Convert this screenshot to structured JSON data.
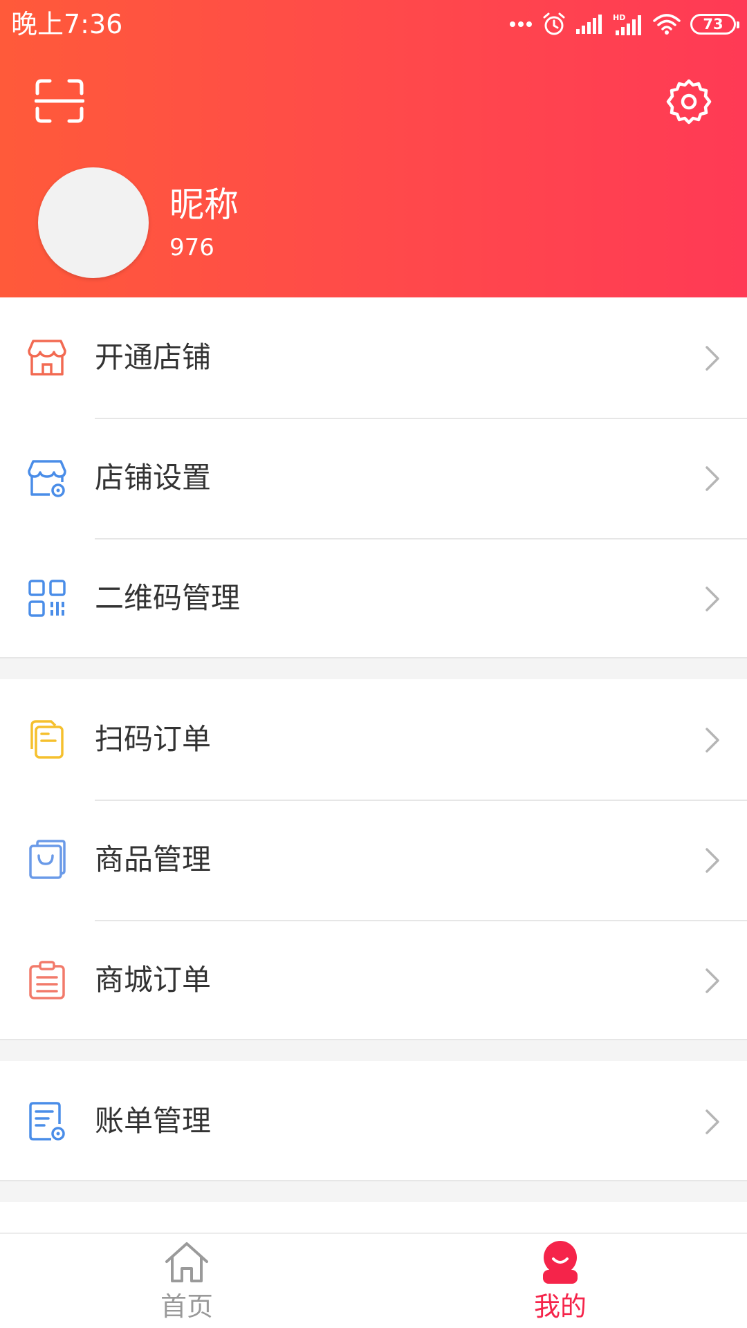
{
  "status_bar": {
    "time": "晚上7:36",
    "battery": "73"
  },
  "header": {
    "nickname": "昵称",
    "user_id": "976",
    "scan_icon": "scan-icon",
    "settings_icon": "gear-icon"
  },
  "menu": {
    "group1": [
      {
        "label": "开通店铺",
        "icon": "open-store-icon"
      },
      {
        "label": "店铺设置",
        "icon": "store-settings-icon"
      },
      {
        "label": "二维码管理",
        "icon": "qr-code-icon"
      }
    ],
    "group2": [
      {
        "label": "扫码订单",
        "icon": "scan-order-icon"
      },
      {
        "label": "商品管理",
        "icon": "shopping-bag-icon"
      },
      {
        "label": "商城订单",
        "icon": "clipboard-icon"
      }
    ],
    "group3": [
      {
        "label": "账单管理",
        "icon": "bill-settings-icon"
      }
    ]
  },
  "bottom_nav": {
    "home": {
      "label": "首页",
      "icon": "home-icon"
    },
    "mine": {
      "label": "我的",
      "icon": "user-icon"
    }
  },
  "colors": {
    "header_start": "#ff5a3a",
    "header_end": "#ff3a55",
    "active_tab": "#f5244a",
    "inactive_tab": "#999999"
  }
}
